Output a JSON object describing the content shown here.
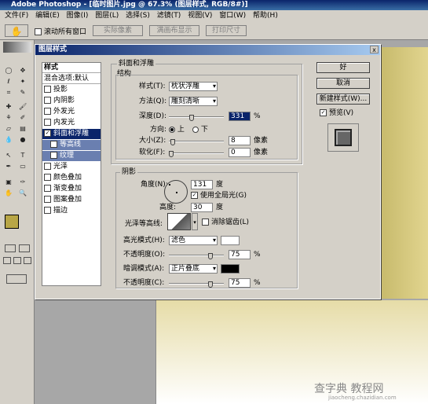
{
  "app": {
    "title": "Adobe Photoshop - [临时图片.jpg @ 67.3% (图层样式, RGB/8#)]"
  },
  "menu": [
    "文件(F)",
    "编辑(E)",
    "图像(I)",
    "图层(L)",
    "选择(S)",
    "滤镜(T)",
    "视图(V)",
    "窗口(W)",
    "帮助(H)"
  ],
  "options": {
    "scroll_all": "滚动所有窗口",
    "actual_pixels": "实际像素",
    "fit_screen": "满画布显示",
    "print_size": "打印尺寸"
  },
  "dialog": {
    "title": "图层样式",
    "close": "x",
    "styles_header": "样式",
    "blend_options": "混合选项:默认",
    "items": [
      {
        "label": "投影",
        "checked": false
      },
      {
        "label": "内阴影",
        "checked": false
      },
      {
        "label": "外发光",
        "checked": false
      },
      {
        "label": "内发光",
        "checked": false
      },
      {
        "label": "斜面和浮雕",
        "checked": true
      },
      {
        "label": "等高线",
        "checked": false
      },
      {
        "label": "纹理",
        "checked": false
      },
      {
        "label": "光泽",
        "checked": false
      },
      {
        "label": "颜色叠加",
        "checked": false
      },
      {
        "label": "渐变叠加",
        "checked": false
      },
      {
        "label": "图案叠加",
        "checked": false
      },
      {
        "label": "描边",
        "checked": false
      }
    ],
    "bevel": {
      "section": "斜面和浮雕",
      "structure": "结构",
      "style_label": "样式(T):",
      "style_value": "枕状浮雕",
      "method_label": "方法(Q):",
      "method_value": "雕刻清晰",
      "depth_label": "深度(D):",
      "depth_value": "331",
      "depth_unit": "%",
      "direction_label": "方向:",
      "dir_up": "上",
      "dir_down": "下",
      "size_label": "大小(Z):",
      "size_value": "8",
      "size_unit": "像素",
      "soften_label": "软化(F):",
      "soften_value": "0",
      "soften_unit": "像素"
    },
    "shading": {
      "section": "阴影",
      "angle_label": "角度(N):",
      "angle_value": "131",
      "angle_unit": "度",
      "global_light": "使用全局光(G)",
      "altitude_label": "高度:",
      "altitude_value": "30",
      "altitude_unit": "度",
      "gloss_label": "光泽等高线:",
      "anti_alias": "消除锯齿(L)",
      "highlight_label": "高光模式(H):",
      "highlight_mode": "滤色",
      "highlight_color": "#ffffff",
      "opacity1_label": "不透明度(O):",
      "opacity1_value": "75",
      "opacity1_unit": "%",
      "shadow_label": "暗调模式(A):",
      "shadow_mode": "正片叠底",
      "shadow_color": "#000000",
      "opacity2_label": "不透明度(C):",
      "opacity2_value": "75",
      "opacity2_unit": "%"
    },
    "buttons": {
      "ok": "好",
      "cancel": "取消",
      "new_style": "新建样式(W)...",
      "preview": "预览(V)"
    }
  },
  "watermark": {
    "text": "查字典 教程网",
    "url": "jiaocheng.chazidian.com"
  },
  "colors": {
    "foreground": "#b8a646",
    "background": "#ffffff"
  }
}
